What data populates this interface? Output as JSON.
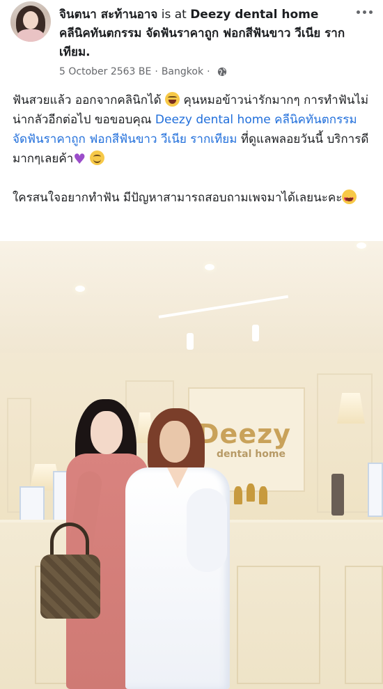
{
  "post": {
    "author": "จินตนา สะท้านอาจ",
    "connector": " is at ",
    "place_line": "Deezy dental home คลีนิคทันตกรรม จัดฟันราคาถูก ฟอกสีฟันขาว วีเนีย รากเทียม.",
    "date": "5 October 2563 BE",
    "separator": "·",
    "location": "Bangkok",
    "privacy_icon": "globe-icon",
    "more_icon": "ellipsis-icon"
  },
  "body": {
    "p1_a": "ฟันสวยแล้ว ออกจากคลินิกได้ ",
    "p1_b": " คุนหมอข้าวน่ารักมากๆ การทำฟันไม่น่ากลัวอีกต่อไป ขอขอบคุณ ",
    "p1_link": "Deezy dental home คลีนิคทันตกรรม จัดฟันราคาถูก ฟอกสีฟันขาว วีเนีย รากเทียม",
    "p1_c": " ที่ดูแลพลอยวันนี้ บริการดีมากๆเลยค้า",
    "p2": "ใครสนใจอยากทำฟัน มีปัญหาสามารถสอบถามเพจมาได้เลยนะคะ"
  },
  "photo": {
    "sign_main": "Deezy",
    "sign_sub": "dental home"
  },
  "colors": {
    "link": "#216fdb",
    "meta": "#65676b",
    "text": "#1c1e21"
  }
}
